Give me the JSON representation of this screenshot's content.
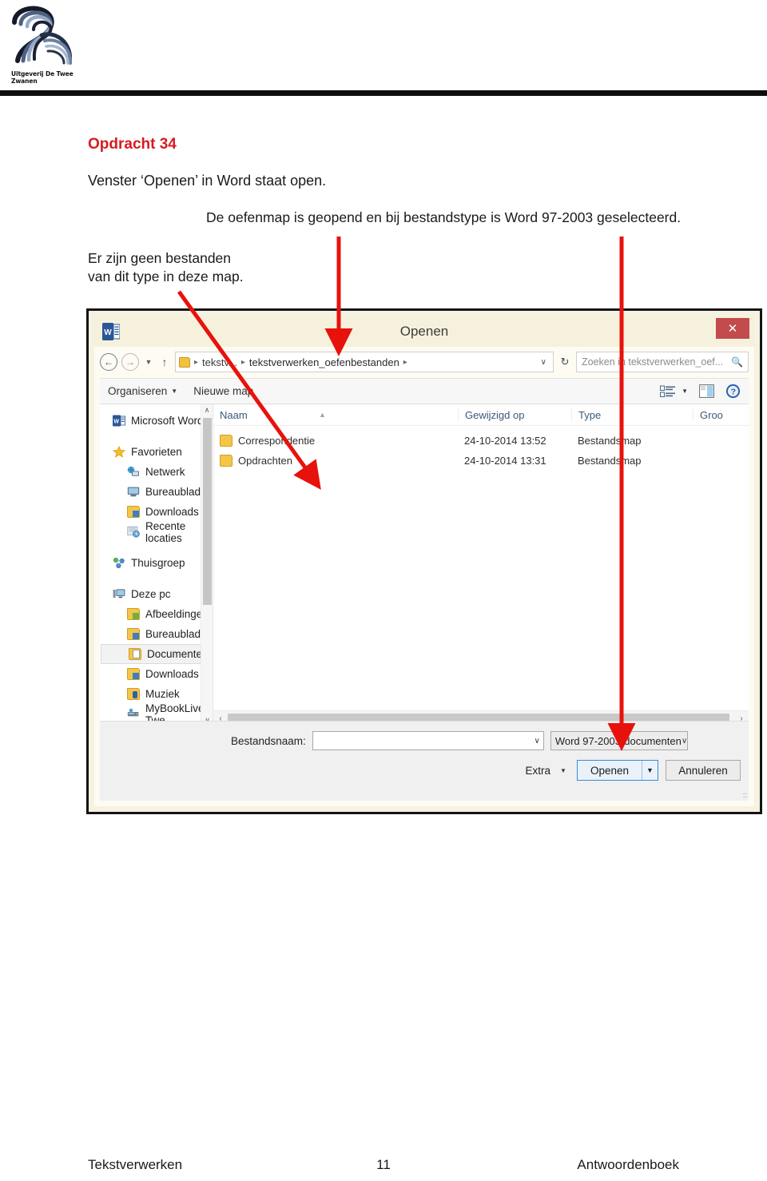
{
  "brand": {
    "logo_caption": "Uitgeverij De Twee Zwanen",
    "logo_icon": "swan-logo"
  },
  "task": {
    "title": "Opdracht 34",
    "line1": "Venster ‘Openen’ in Word staat open.",
    "note_right": "De oefenmap is geopend en bij bestandstype is Word 97-2003 geselecteerd.",
    "note_left": "Er zijn geen bestanden\nvan dit type in deze map."
  },
  "colors": {
    "accent_red": "#d91a21",
    "annotation_red": "#e8120c",
    "titlebar": "#f6f1dd",
    "close_button": "#c34b4b",
    "selection_blue": "#3b8ad1",
    "column_header_text": "#3a5a78"
  },
  "dialog": {
    "title": "Openen",
    "app_icon": "word-icon",
    "close_label": "✕",
    "nav": {
      "back_icon": "back-arrow-icon",
      "forward_icon": "forward-arrow-icon",
      "history_caret": "▼",
      "up_icon": "↑",
      "refresh_icon": "↻"
    },
    "address": {
      "folder_icon": "folder-icon",
      "crumbs": [
        "tekstv...",
        "tekstverwerken_oefenbestanden"
      ],
      "separator": "▸",
      "dropdown_caret": "∨"
    },
    "search": {
      "placeholder": "Zoeken in tekstverwerken_oef...",
      "icon": "search-icon"
    },
    "toolbar": {
      "organize_label": "Organiseren",
      "organize_caret": "▼",
      "new_folder_label": "Nieuwe map",
      "view_icon": "view-options-icon",
      "view_caret": "▼",
      "pane_icon": "preview-pane-icon",
      "help_icon": "help-icon"
    },
    "nav_pane": {
      "groups": [
        {
          "items": [
            {
              "label": "Microsoft Word",
              "icon": "word-icon",
              "indent": false,
              "selected": false
            }
          ]
        },
        {
          "items": [
            {
              "label": "Favorieten",
              "icon": "star-icon",
              "indent": false,
              "selected": false
            },
            {
              "label": "Netwerk",
              "icon": "network-icon",
              "indent": true,
              "selected": false
            },
            {
              "label": "Bureaublad",
              "icon": "desktop-icon",
              "indent": true,
              "selected": false
            },
            {
              "label": "Downloads",
              "icon": "downloads-folder-icon",
              "indent": true,
              "selected": false
            },
            {
              "label": "Recente locaties",
              "icon": "recent-locations-icon",
              "indent": true,
              "selected": false
            }
          ]
        },
        {
          "items": [
            {
              "label": "Thuisgroep",
              "icon": "homegroup-icon",
              "indent": false,
              "selected": false
            }
          ]
        },
        {
          "items": [
            {
              "label": "Deze pc",
              "icon": "this-pc-icon",
              "indent": false,
              "selected": false
            },
            {
              "label": "Afbeeldingen",
              "icon": "pictures-folder-icon",
              "indent": true,
              "selected": false
            },
            {
              "label": "Bureaublad",
              "icon": "desktop-folder-icon",
              "indent": true,
              "selected": false
            },
            {
              "label": "Documenten",
              "icon": "documents-folder-icon",
              "indent": true,
              "selected": true
            },
            {
              "label": "Downloads",
              "icon": "downloads-folder-icon",
              "indent": true,
              "selected": false
            },
            {
              "label": "Muziek",
              "icon": "music-folder-icon",
              "indent": true,
              "selected": false
            },
            {
              "label": "MyBookLive-Twe",
              "icon": "network-drive-icon",
              "indent": true,
              "selected": false
            }
          ]
        }
      ],
      "scroll_up_icon": "∧",
      "scroll_down_icon": "∨"
    },
    "file_list": {
      "columns": [
        "Naam",
        "Gewijzigd op",
        "Type",
        "Groo"
      ],
      "sort_indicator": "▲",
      "rows": [
        {
          "naam": "Correspondentie",
          "gewijzigd": "24-10-2014 13:52",
          "type": "Bestandsmap",
          "icon": "folder-icon"
        },
        {
          "naam": "Opdrachten",
          "gewijzigd": "24-10-2014 13:31",
          "type": "Bestandsmap",
          "icon": "folder-icon"
        }
      ],
      "hscroll_left_icon": "‹",
      "hscroll_right_icon": "›"
    },
    "bottom": {
      "filename_label": "Bestandsnaam:",
      "filename_value": "",
      "filename_caret": "∨",
      "filter_value": "Word 97-2003-documenten",
      "filter_caret": "∨",
      "extra_label": "Extra",
      "extra_caret": "▼",
      "open_label": "Openen",
      "open_split_caret": "▼",
      "cancel_label": "Annuleren",
      "resize_grip": "resize-grip-icon"
    }
  },
  "annotations": [
    {
      "name": "arrow-to-empty-file-area",
      "desc": "diagonal arrow from note to empty file list area"
    },
    {
      "name": "arrow-to-breadcrumb",
      "desc": "vertical arrow to address bar folder name"
    },
    {
      "name": "arrow-to-filetype-dropdown",
      "desc": "long vertical arrow to file type dropdown"
    }
  ],
  "footer": {
    "left": "Tekstverwerken",
    "center": "11",
    "right": "Antwoordenboek"
  }
}
